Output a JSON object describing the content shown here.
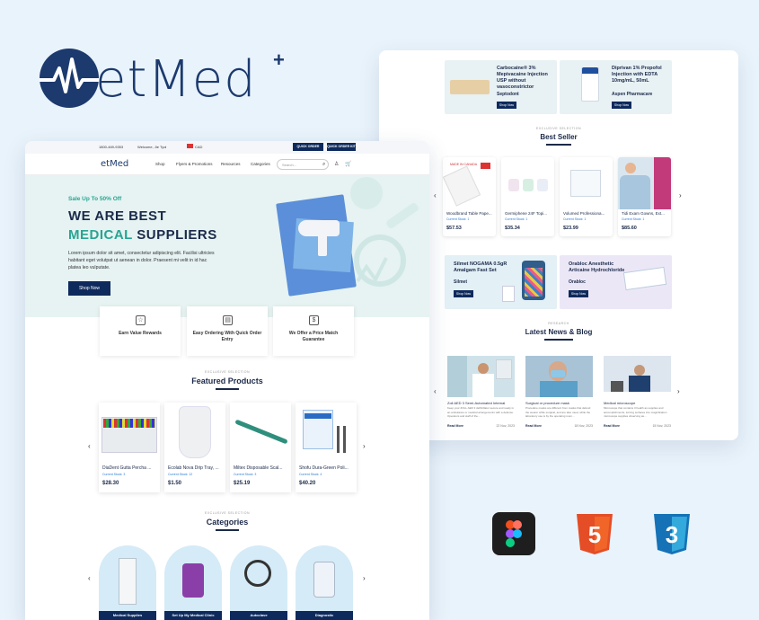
{
  "brand": {
    "name": "etMed",
    "plus": "+"
  },
  "right": {
    "promo_top": [
      {
        "title": "Carbocaine® 3% Mepivacaine Injection USP without vasoconstrictor",
        "sub": "Septodont",
        "btn": "Shop Now"
      },
      {
        "title": "Diprivan 1% Propofol Injection with EDTA 10mg/mL, 50mL",
        "sub": "Aspen Pharmacare",
        "btn": "Shop Now"
      }
    ],
    "bestseller": {
      "kicker": "EXCLUSIVE SELECTION",
      "title": "Best Seller",
      "products": [
        {
          "name": "Woodbrand Table Pape...",
          "stock": "Current Stock: 1",
          "price": "$57.53",
          "img_text": "MADE IN CANADA"
        },
        {
          "name": "Germiphene 24F Topi...",
          "stock": "Current Stock: 1",
          "price": "$35.34"
        },
        {
          "name": "Volumed Professiona...",
          "stock": "Current Stock: 1",
          "price": "$23.99"
        },
        {
          "name": "Tidi Exam Gowns, Ext...",
          "stock": "Current Stock: 1",
          "price": "$85.60"
        }
      ]
    },
    "promo_mid": [
      {
        "title": "Silmet NOGAMA 0.5gR Amalgam Fast Set",
        "sub": "Silmet",
        "btn": "Shop Now"
      },
      {
        "title": "Orabloc Anesthetic Articaine Hydrochloride",
        "sub": "Orabloc",
        "btn": "Shop Now"
      }
    ],
    "news": {
      "kicker": "RESEARCH",
      "title": "Latest News & Blog",
      "items": [
        {
          "title": "Zoll AED 3 Semi-Automated Internal",
          "text": "Keep your ZOLL AED 3 defibrillator secure and ready in an ambulance or medical arrangements with a defense. Operators and staff of the...",
          "read": "Read More",
          "date": "22 Nov, 2023"
        },
        {
          "title": "Surgical or procedure mask",
          "text": "Procedure masks are different from masks that defend the wearer while surgical, and are also used, while the laboratory use is by the operating room...",
          "read": "Read More",
          "date": "18 Nov, 2023"
        },
        {
          "title": "Medical microscope",
          "text": "Microscope that contains 3 health as supplies and accomplishments, turning surfaces into magnification microscope supplies observing as...",
          "read": "Read More",
          "date": "15 Nov, 2023"
        }
      ]
    },
    "prev": "‹",
    "next": "›"
  },
  "left": {
    "topbar": {
      "phone": "1800-469-9353",
      "welcome": "Welcome, Jie Tyol",
      "flag": "CAD",
      "btn1": "QUICK ORDER ENTRY",
      "btn2": "QUICK ORDER KIT"
    },
    "nav": {
      "logo": "etMed",
      "items": [
        "Shop",
        "Flyers & Promotions",
        "Resources",
        "Categories"
      ],
      "search_placeholder": "Search..."
    },
    "hero": {
      "sale": "Sale Up To 50% Off",
      "line1": "WE ARE BEST",
      "line2a": "MEDICAL",
      "line2b": "SUPPLIERS",
      "para": "Lorem ipsum dolor sit amet, consectetur adipiscing elit. Facilisi ultricies habitant eget volutpat ut aenean in dolor. Praesent mi velit in id hac platea leo vulputate.",
      "btn": "Shop Now"
    },
    "features": [
      {
        "label": "Earn Value Rewards",
        "icon": "star-icon"
      },
      {
        "label": "Easy Ordering With Quick Order Entry",
        "icon": "clipboard-icon"
      },
      {
        "label": "We Offer a Price Match Guarantee",
        "icon": "price-tag-icon"
      }
    ],
    "featured": {
      "kicker": "EXCLUSIVE SELECTION",
      "title": "Featured Products",
      "products": [
        {
          "name": "DiaDent Gutta Percha ...",
          "stock": "Current Stock: 3",
          "price": "$28.30"
        },
        {
          "name": "Ecolab Nova Drip Tray, ...",
          "stock": "Current Stock: 12",
          "price": "$1.50"
        },
        {
          "name": "Miltex Disposable Scal...",
          "stock": "Current Stock: 3",
          "price": "$25.19"
        },
        {
          "name": "Shofu Dura-Green Poli...",
          "stock": "Current Stock: 4",
          "price": "$40.20"
        }
      ]
    },
    "categories": {
      "kicker": "EXCLUSIVE SELECTION",
      "title": "Categories",
      "items": [
        "Medical Supplies",
        "Set Up My Medical Clinic",
        "Autoclave",
        "Diagnostic"
      ]
    },
    "prev": "‹",
    "next": "›"
  },
  "colors": {
    "navy": "#0e2a5c",
    "teal": "#27a592",
    "hero_bg": "#e6f3f2",
    "page_bg": "#e9f3fb"
  },
  "tech_icons": [
    "figma-icon",
    "html5-icon",
    "css3-icon"
  ]
}
